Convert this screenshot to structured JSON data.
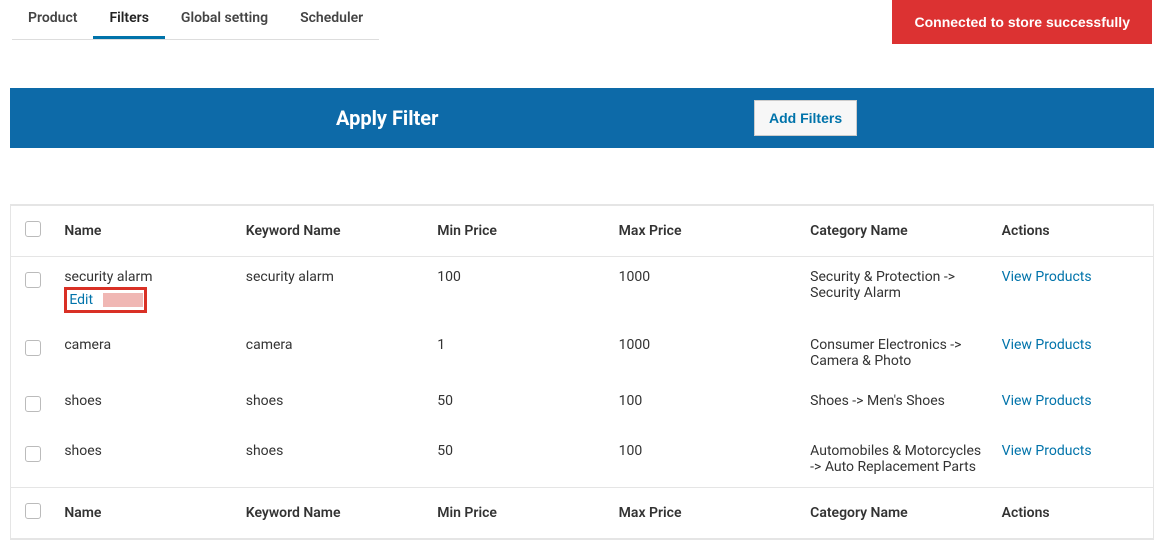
{
  "tabs": {
    "product": "Product",
    "filters": "Filters",
    "global": "Global setting",
    "scheduler": "Scheduler"
  },
  "connected": "Connected to store successfully",
  "applyBar": {
    "title": "Apply Filter",
    "addFilters": "Add Filters"
  },
  "columns": {
    "name": "Name",
    "keyword": "Keyword Name",
    "min": "Min Price",
    "max": "Max Price",
    "category": "Category Name",
    "actions": "Actions"
  },
  "rowActions": {
    "edit": "Edit"
  },
  "viewLabel": "View Products",
  "rows": [
    {
      "name": "security alarm",
      "keyword": "security alarm",
      "min": "100",
      "max": "1000",
      "category": "Security & Protection -> Security Alarm",
      "showEdit": true
    },
    {
      "name": "camera",
      "keyword": "camera",
      "min": "1",
      "max": "1000",
      "category": "Consumer Electronics -> Camera & Photo",
      "showEdit": false
    },
    {
      "name": "shoes",
      "keyword": "shoes",
      "min": "50",
      "max": "100",
      "category": "Shoes -> Men's Shoes",
      "showEdit": false
    },
    {
      "name": "shoes",
      "keyword": "shoes",
      "min": "50",
      "max": "100",
      "category": "Automobiles & Motorcycles -> Auto Replacement Parts",
      "showEdit": false
    }
  ]
}
